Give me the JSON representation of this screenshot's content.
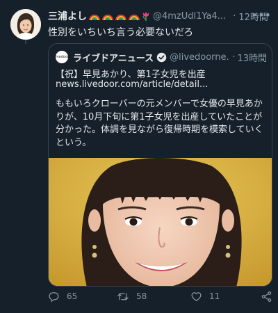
{
  "tweet": {
    "display_name": "三浦よし",
    "handle": "@4mzUdl1Ya4...",
    "separator": "·",
    "time": "12時間",
    "text": "性別をいちいち言う必要ないだろ",
    "more_icon": "more-dots-icon",
    "emojis": [
      "rainbow-icon",
      "rainbow-icon",
      "rainbow-icon",
      "rainbow-icon",
      "tulip-icon"
    ]
  },
  "quote": {
    "avatar_text": "livedoor",
    "name": "ライブドアニュース",
    "handle": "@livedoorne...",
    "separator": "·",
    "time": "13時間",
    "title": "【祝】早見あかり、第1子女児を出産",
    "link": "news.livedoor.com/article/detail...",
    "body": "ももいろクローバーの元メンバーで女優の早見あかりが、10月下旬に第1子女児を出産していたことが分かった。体調を見ながら復帰時期を模索していくという。"
  },
  "actions": {
    "reply_count": "65",
    "retweet_count": "58",
    "like_count": "11"
  },
  "colors": {
    "background": "#15202b",
    "text": "#e7e9ea",
    "secondary": "#8899a6",
    "border": "#38444d",
    "verified": "#1d9bf0"
  }
}
